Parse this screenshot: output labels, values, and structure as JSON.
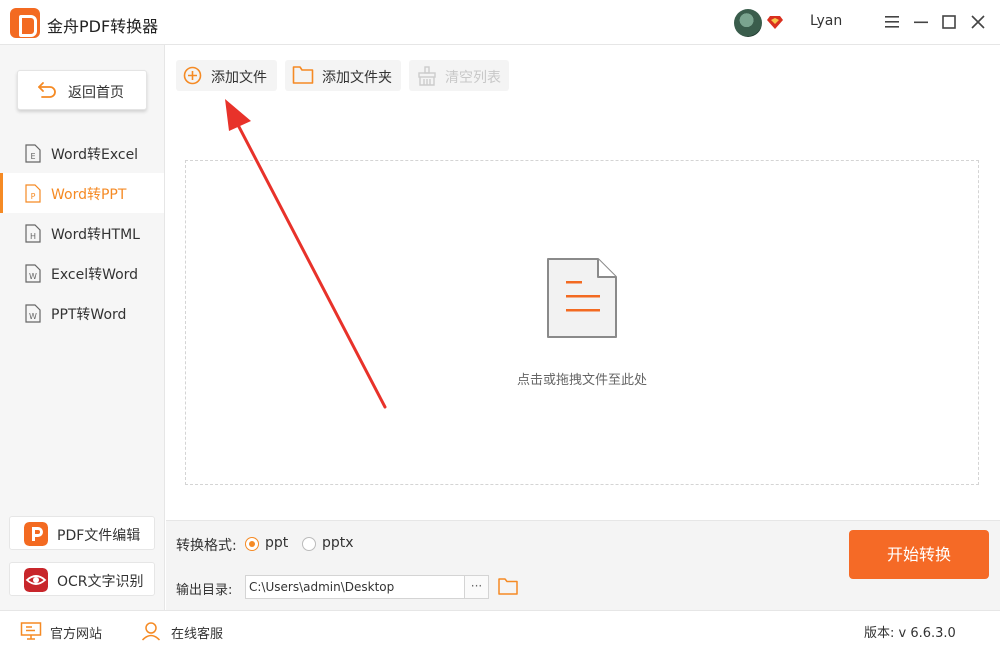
{
  "titlebar": {
    "app_title": "金舟PDF转换器",
    "username": "Lyan"
  },
  "sidebar": {
    "home_label": "返回首页",
    "items": [
      {
        "label": "Word转Excel",
        "letter": "E"
      },
      {
        "label": "Word转PPT",
        "letter": "P",
        "active": true
      },
      {
        "label": "Word转HTML",
        "letter": "H"
      },
      {
        "label": "Excel转Word",
        "letter": "W"
      },
      {
        "label": "PPT转Word",
        "letter": "W"
      }
    ],
    "tools": [
      {
        "label": "PDF文件编辑"
      },
      {
        "label": "OCR文字识别"
      }
    ]
  },
  "toolbar": {
    "add_file": "添加文件",
    "add_folder": "添加文件夹",
    "clear_list": "清空列表"
  },
  "dropzone": {
    "hint": "点击或拖拽文件至此处"
  },
  "settings": {
    "format_label": "转换格式:",
    "formats": [
      {
        "label": "ppt",
        "checked": true
      },
      {
        "label": "pptx",
        "checked": false
      }
    ],
    "output_label": "输出目录:",
    "output_path": "C:\\Users\\admin\\Desktop",
    "browse_label": "···",
    "start_label": "开始转换"
  },
  "statusbar": {
    "website": "官方网站",
    "support": "在线客服",
    "version": "版本: v 6.6.3.0"
  },
  "colors": {
    "accent": "#f58a24",
    "start_button": "#f56a26",
    "arrow": "#e8322a"
  }
}
